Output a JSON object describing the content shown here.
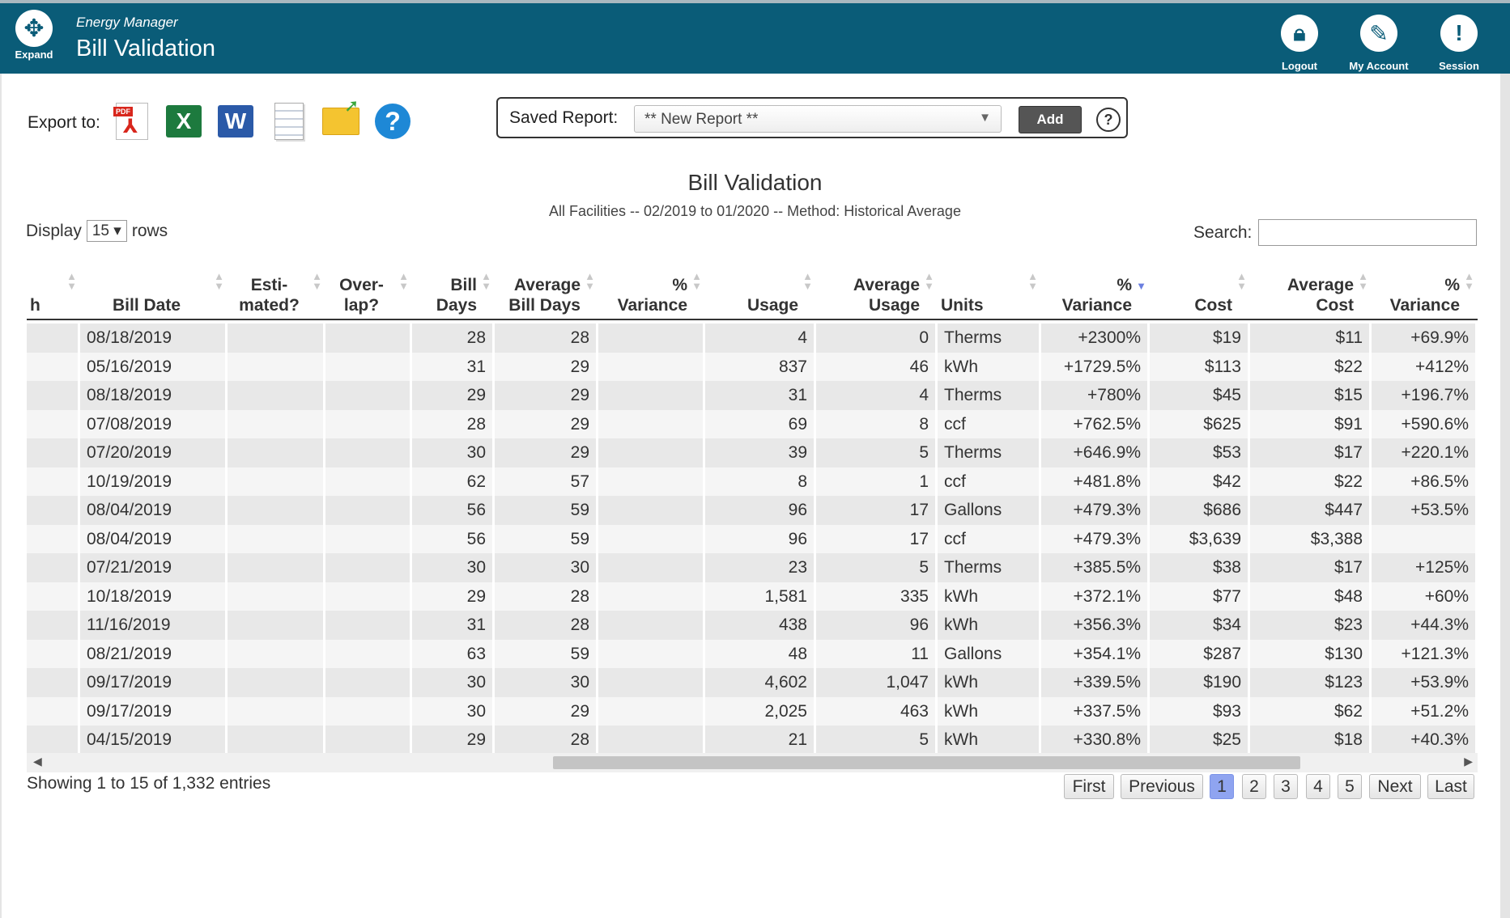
{
  "header": {
    "expand_label": "Expand",
    "app_name": "Energy Manager",
    "page_title": "Bill Validation",
    "tools": [
      {
        "label": "Logout",
        "icon": "lock-icon"
      },
      {
        "label": "My Account",
        "icon": "clipboard-edit-icon"
      },
      {
        "label": "Session",
        "icon": "exclamation-icon"
      }
    ]
  },
  "export": {
    "label": "Export to:",
    "formats": [
      "pdf-icon",
      "excel-icon",
      "word-icon",
      "text-icon",
      "email-icon",
      "help-icon"
    ]
  },
  "saved_report": {
    "label": "Saved Report:",
    "selected": "** New Report **",
    "add_label": "Add",
    "help": "?"
  },
  "report": {
    "title": "Bill Validation",
    "subtitle": "All Facilities -- 02/2019 to 01/2020 -- Method: Historical Average"
  },
  "display": {
    "prefix": "Display",
    "value": "15",
    "suffix": "rows"
  },
  "search": {
    "label": "Search:",
    "value": ""
  },
  "table": {
    "columns": [
      "h",
      "Bill Date",
      "Esti- mated?",
      "Over- lap?",
      "Bill Days",
      "Average Bill Days",
      "% Variance",
      "Usage",
      "Average Usage",
      "Units",
      "% Variance",
      "Cost",
      "Average Cost",
      "% Variance"
    ],
    "rows": [
      [
        "",
        "08/18/2019",
        "",
        "",
        "28",
        "28",
        "",
        "4",
        "0",
        "Therms",
        "+2300%",
        "$19",
        "$11",
        "+69.9%"
      ],
      [
        "",
        "05/16/2019",
        "",
        "",
        "31",
        "29",
        "",
        "837",
        "46",
        "kWh",
        "+1729.5%",
        "$113",
        "$22",
        "+412%"
      ],
      [
        "",
        "08/18/2019",
        "",
        "",
        "29",
        "29",
        "",
        "31",
        "4",
        "Therms",
        "+780%",
        "$45",
        "$15",
        "+196.7%"
      ],
      [
        "",
        "07/08/2019",
        "",
        "",
        "28",
        "29",
        "",
        "69",
        "8",
        "ccf",
        "+762.5%",
        "$625",
        "$91",
        "+590.6%"
      ],
      [
        "",
        "07/20/2019",
        "",
        "",
        "30",
        "29",
        "",
        "39",
        "5",
        "Therms",
        "+646.9%",
        "$53",
        "$17",
        "+220.1%"
      ],
      [
        "",
        "10/19/2019",
        "",
        "",
        "62",
        "57",
        "",
        "8",
        "1",
        "ccf",
        "+481.8%",
        "$42",
        "$22",
        "+86.5%"
      ],
      [
        "",
        "08/04/2019",
        "",
        "",
        "56",
        "59",
        "",
        "96",
        "17",
        "Gallons",
        "+479.3%",
        "$686",
        "$447",
        "+53.5%"
      ],
      [
        "",
        "08/04/2019",
        "",
        "",
        "56",
        "59",
        "",
        "96",
        "17",
        "ccf",
        "+479.3%",
        "$3,639",
        "$3,388",
        ""
      ],
      [
        "",
        "07/21/2019",
        "",
        "",
        "30",
        "30",
        "",
        "23",
        "5",
        "Therms",
        "+385.5%",
        "$38",
        "$17",
        "+125%"
      ],
      [
        "",
        "10/18/2019",
        "",
        "",
        "29",
        "28",
        "",
        "1,581",
        "335",
        "kWh",
        "+372.1%",
        "$77",
        "$48",
        "+60%"
      ],
      [
        "",
        "11/16/2019",
        "",
        "",
        "31",
        "28",
        "",
        "438",
        "96",
        "kWh",
        "+356.3%",
        "$34",
        "$23",
        "+44.3%"
      ],
      [
        "",
        "08/21/2019",
        "",
        "",
        "63",
        "59",
        "",
        "48",
        "11",
        "Gallons",
        "+354.1%",
        "$287",
        "$130",
        "+121.3%"
      ],
      [
        "",
        "09/17/2019",
        "",
        "",
        "30",
        "30",
        "",
        "4,602",
        "1,047",
        "kWh",
        "+339.5%",
        "$190",
        "$123",
        "+53.9%"
      ],
      [
        "",
        "09/17/2019",
        "",
        "",
        "30",
        "29",
        "",
        "2,025",
        "463",
        "kWh",
        "+337.5%",
        "$93",
        "$62",
        "+51.2%"
      ],
      [
        "",
        "04/15/2019",
        "",
        "",
        "29",
        "28",
        "",
        "21",
        "5",
        "kWh",
        "+330.8%",
        "$25",
        "$18",
        "+40.3%"
      ]
    ]
  },
  "footer": {
    "showing": "Showing 1 to 15 of 1,332 entries",
    "pager": [
      "First",
      "Previous",
      "1",
      "2",
      "3",
      "4",
      "5",
      "Next",
      "Last"
    ],
    "current_page": "1"
  },
  "colors": {
    "header_bg": "#0a5c78",
    "current_page": "#8fa4f0"
  }
}
